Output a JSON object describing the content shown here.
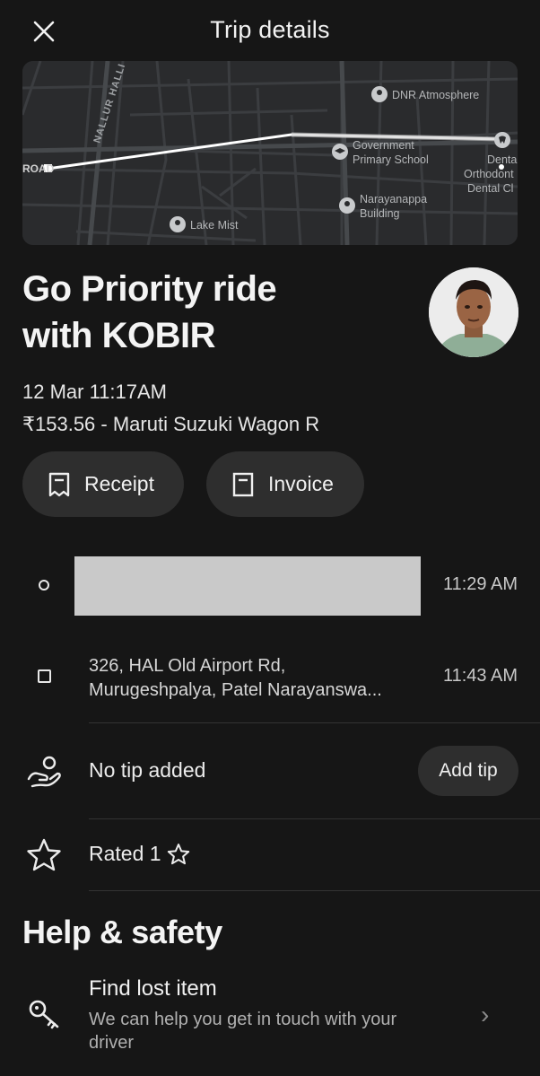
{
  "header": {
    "title": "Trip details",
    "close_icon": "close-icon"
  },
  "map": {
    "road_labels": [
      "NALLUR HALLI",
      "ROAD"
    ],
    "pois": [
      {
        "label": [
          "DNR Atmosphere"
        ],
        "icon": "pin-icon"
      },
      {
        "label": [
          "Government",
          "Primary School"
        ],
        "icon": "school-icon"
      },
      {
        "label": [
          "Narayanappa",
          "Building"
        ],
        "icon": "pin-icon"
      },
      {
        "label": [
          "Lake Mist"
        ],
        "icon": "pin-icon"
      },
      {
        "label": [
          "Dental",
          "Orthodont",
          "Dental Cl"
        ],
        "icon": "dental-icon"
      }
    ],
    "route_color": "#ffffff",
    "background_color": "#2a2b2d"
  },
  "ride": {
    "title_line1": "Go Priority ride",
    "title_line2": "with KOBIR",
    "datetime": "12 Mar 11:17AM",
    "fare_vehicle": "₹153.56 - Maruti Suzuki Wagon R"
  },
  "actions": {
    "receipt_label": "Receipt",
    "invoice_label": "Invoice"
  },
  "route": {
    "pickup": {
      "address": "",
      "time": "11:29 AM",
      "redacted": true
    },
    "dropoff": {
      "address_line1": "326, HAL Old Airport Rd,",
      "address_line2": "Murugeshpalya, Patel Narayanswa...",
      "time": "11:43 AM"
    }
  },
  "tip": {
    "status": "No tip added",
    "button_label": "Add tip",
    "icon": "hand-coin-icon"
  },
  "rating": {
    "text": "Rated 1",
    "value": 1,
    "icon": "star-icon"
  },
  "help": {
    "heading": "Help & safety",
    "items": [
      {
        "title": "Find lost item",
        "description": "We can help you get in touch with your driver",
        "icon": "key-icon",
        "chevron": "›"
      }
    ]
  }
}
